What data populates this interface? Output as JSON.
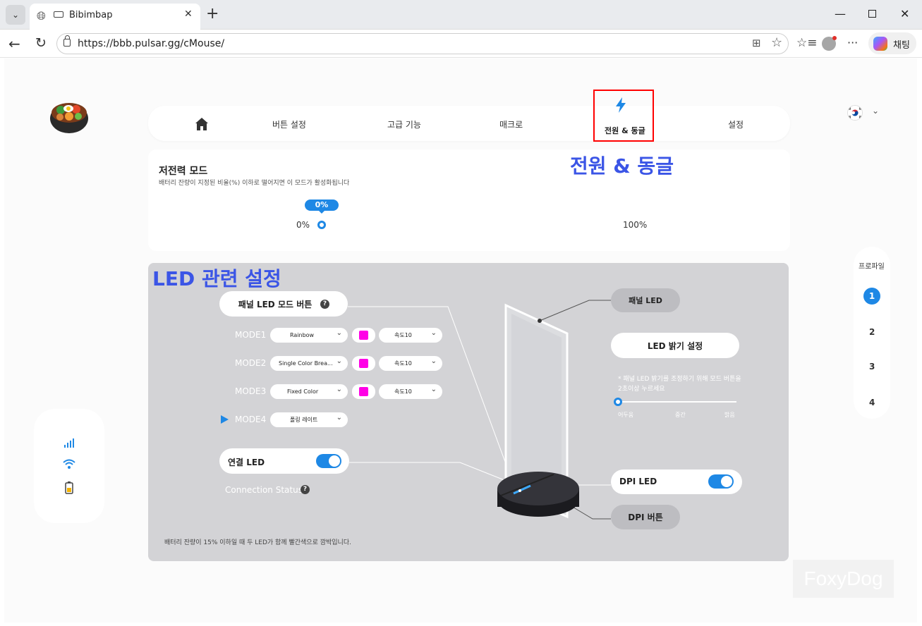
{
  "browser": {
    "tab_title": "Bibimbap",
    "url": "https://bbb.pulsar.gg/cMouse/",
    "copilot_label": "채팅"
  },
  "nav": {
    "items": [
      "버튼 설정",
      "고급 기능",
      "매크로",
      "전원 & 동글",
      "설정"
    ],
    "active": "전원 & 동글"
  },
  "overlay": {
    "power_title": "전원 & 동글",
    "led_title": "LED 관련 설정"
  },
  "low_power": {
    "title": "저전력 모드",
    "description": "배터리 잔량이 지정된 비율(%) 이하로 떨어지면 이 모드가 활성화됩니다",
    "value_label": "0%",
    "min_label": "0%",
    "max_label": "100%",
    "value_percent": 0
  },
  "led": {
    "panel_mode_button": "패널 LED 모드 버튼",
    "help_glyph": "?",
    "modes": [
      {
        "label": "MODE1",
        "effect": "Rainbow",
        "speed": "속도10"
      },
      {
        "label": "MODE2",
        "effect": "Single Color Brea...",
        "speed": "속도10"
      },
      {
        "label": "MODE3",
        "effect": "Fixed Color",
        "speed": "속도10"
      },
      {
        "label": "MODE4",
        "effect": "폴링 레이트"
      }
    ],
    "active_mode": "MODE4",
    "swatch_color": "#ff00e6",
    "connection_led": "연결 LED",
    "connection_led_on": true,
    "connection_status": "Connection Status",
    "battery_note": "배터리 잔량이 15% 이하일 때 두 LED가 함께 빨간색으로 깜박입니다.",
    "panel_led_tag": "패널 LED",
    "brightness_button": "LED 밝기 설정",
    "brightness_note": "* 패널 LED 밝기를 조정하기 위해 모드 버튼을 2초이상 누르세요",
    "brightness_labels": [
      "어두움",
      "중간",
      "밝음"
    ],
    "brightness_value": "어두움",
    "dpi_led": "DPI LED",
    "dpi_led_on": true,
    "dpi_button_tag": "DPI 버튼"
  },
  "profile": {
    "title": "프로파일",
    "items": [
      "1",
      "2",
      "3",
      "4"
    ],
    "active": "1"
  },
  "watermark": "FoxyDog",
  "colors": {
    "accent": "#1e88e5",
    "annotation": "#3b55e6",
    "highlight_box": "#ff0000",
    "led_card_bg": "#d3d3d6"
  },
  "icons": [
    "home-icon",
    "power-bolt-icon",
    "korea-flag-icon",
    "signal-bars-icon",
    "wifi-icon",
    "battery-icon"
  ]
}
